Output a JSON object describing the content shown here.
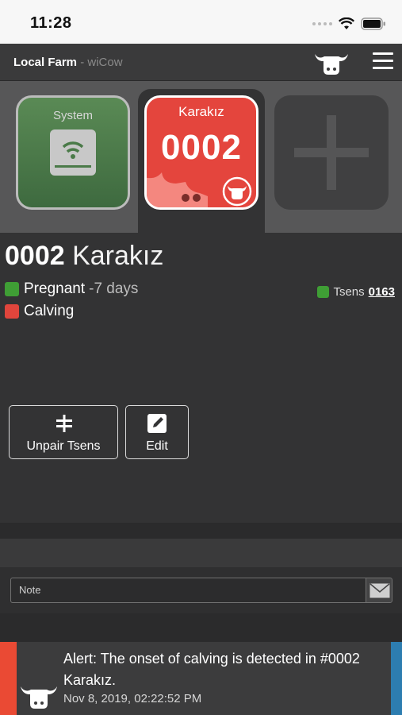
{
  "status_bar": {
    "time": "11:28"
  },
  "header": {
    "farm_name": "Local Farm",
    "separator_app": " - wiCow"
  },
  "cards": {
    "system_label": "System",
    "cow_name": "Karakız",
    "cow_number": "0002"
  },
  "detail": {
    "number": "0002",
    "name": "Karakız",
    "statuses": [
      {
        "label": "Pregnant",
        "extra": "-7 days",
        "color": "#3f9e35"
      },
      {
        "label": "Calving",
        "extra": "",
        "color": "#e0453c"
      }
    ],
    "tsens_label": "Tsens",
    "tsens_id": "0163",
    "buttons": {
      "unpair": "Unpair Tsens",
      "edit": "Edit"
    }
  },
  "note": {
    "placeholder": "Note"
  },
  "alert": {
    "message": "Alert: The onset of calving is detected in #0002 Karakız.",
    "timestamp": "Nov 8, 2019, 02:22:52 PM"
  },
  "colors": {
    "alert_red": "#ea4a34",
    "alert_blue": "#2d7db0",
    "cow_card": "#e4453d",
    "system_card": "#4e7c4b"
  }
}
